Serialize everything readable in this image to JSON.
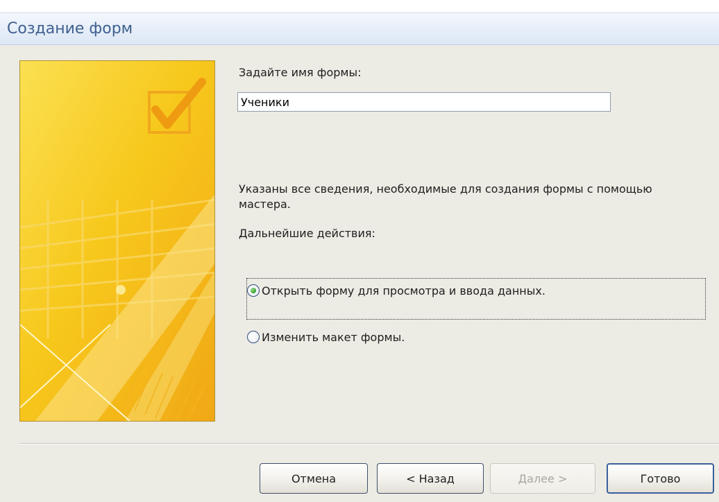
{
  "window": {
    "title": "Создание форм"
  },
  "form_name": {
    "label": "Задайте имя формы:",
    "value": "Ученики"
  },
  "info": {
    "text": "Указаны все сведения, необходимые для создания формы с помощью мастера.",
    "next_steps_label": "Дальнейшие действия:"
  },
  "options": [
    {
      "label": "Открыть форму для просмотра и ввода данных.",
      "selected": true
    },
    {
      "label": "Изменить макет формы.",
      "selected": false
    }
  ],
  "buttons": {
    "cancel": "Отмена",
    "back": "< Назад",
    "next": "Далее >",
    "finish": "Готово"
  },
  "colors": {
    "title_text": "#3f5f8f",
    "dialog_bg": "#ecebe4",
    "art_yellow": "#f5c400"
  },
  "icons": {
    "art": "wizard-checkmark-illustration"
  }
}
